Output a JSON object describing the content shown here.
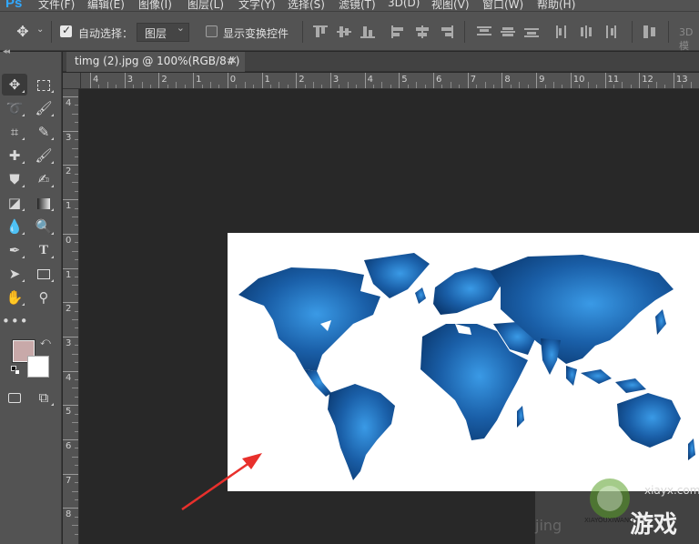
{
  "app": {
    "logo": "Ps"
  },
  "menu": [
    "文件(F)",
    "编辑(E)",
    "图像(I)",
    "图层(L)",
    "文字(Y)",
    "选择(S)",
    "滤镜(T)",
    "3D(D)",
    "视图(V)",
    "窗口(W)",
    "帮助(H)"
  ],
  "options": {
    "auto_select_label": "自动选择：",
    "auto_select_checked": true,
    "auto_select_target": "图层",
    "show_transform_label": "显示变换控件",
    "show_transform_checked": false,
    "mode_3d_label": "3D 模"
  },
  "document": {
    "tab_title": "timg (2).jpg @ 100%(RGB/8#)",
    "close_glyph": "×"
  },
  "rulers": {
    "horizontal_labels": [
      "4",
      "3",
      "2",
      "1",
      "0",
      "1",
      "2",
      "3",
      "4",
      "5",
      "6",
      "7",
      "8",
      "9",
      "10",
      "11",
      "12",
      "13"
    ],
    "vertical_labels": [
      "4",
      "3",
      "2",
      "1",
      "0",
      "1",
      "2",
      "3",
      "4",
      "5",
      "6",
      "7",
      "8"
    ]
  },
  "tools": [
    "move-tool-icon",
    "marquee-tool-icon",
    "lasso-tool-icon",
    "quick-select-tool-icon",
    "crop-tool-icon",
    "eyedropper-tool-icon",
    "healing-brush-tool-icon",
    "brush-tool-icon",
    "clone-stamp-tool-icon",
    "history-brush-tool-icon",
    "eraser-tool-icon",
    "gradient-tool-icon",
    "blur-tool-icon",
    "dodge-tool-icon",
    "pen-tool-icon",
    "type-tool-icon",
    "path-select-tool-icon",
    "rectangle-tool-icon",
    "hand-tool-icon",
    "zoom-tool-icon",
    "more-tools-icon",
    "quick-mask-icon",
    "screen-mode-icon"
  ],
  "colors": {
    "foreground": "#c8a9a9",
    "background": "#ffffff",
    "map_ocean_dark": "#0d3f78",
    "map_light": "#3a96e0",
    "annotation_arrow": "#e8302c"
  },
  "watermark": {
    "url": "xiayx.com",
    "brand": "游戏",
    "sub": "XIAYOUXIWANG",
    "left_text": "jing"
  }
}
